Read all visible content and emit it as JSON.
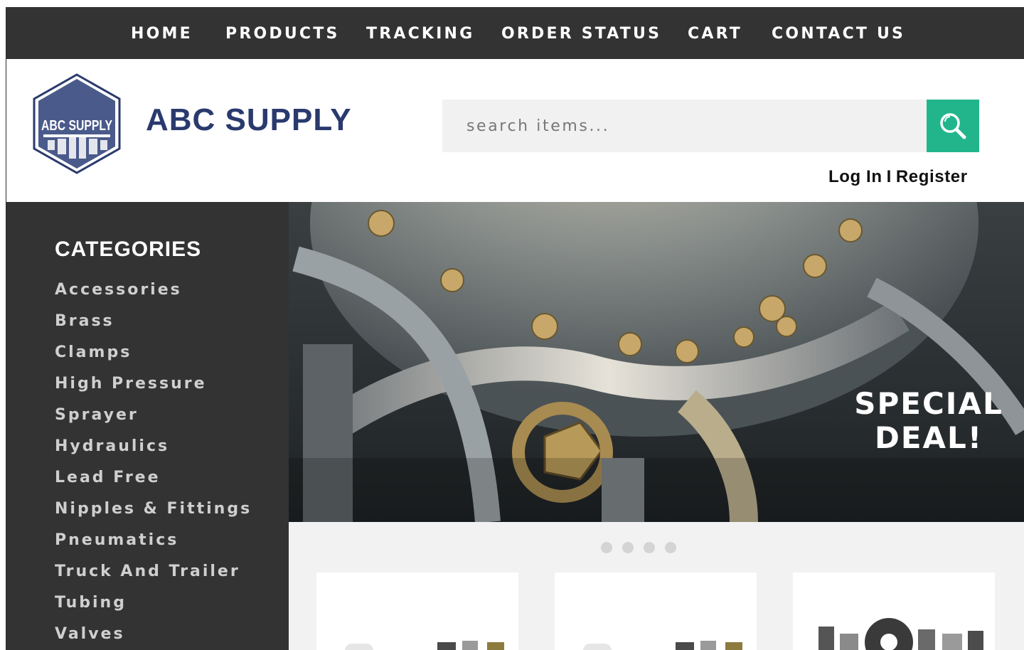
{
  "nav": {
    "items": [
      "HOME",
      "PRODUCTS",
      "TRACKING",
      "ORDER STATUS",
      "CART",
      "CONTACT US"
    ]
  },
  "header": {
    "logo_text": "ABC SUPPLY",
    "brand_name": "ABC SUPPLY",
    "search": {
      "placeholder": "search items...",
      "button_icon": "search-icon"
    },
    "auth": {
      "login": "Log In",
      "separator": "I",
      "register": "Register"
    }
  },
  "sidebar": {
    "title": "CATEGORIES",
    "items": [
      "Accessories",
      "Brass",
      "Clamps",
      "High Pressure",
      "Sprayer",
      "Hydraulics",
      "Lead Free",
      "Nipples & Fittings",
      "Pneumatics",
      "Truck And Trailer",
      "Tubing",
      "Valves"
    ]
  },
  "hero": {
    "headline_line1": "SPECIAL",
    "headline_line2": "DEAL!",
    "slide_count": 4
  },
  "colors": {
    "dark": "#333333",
    "brand_navy": "#2a3a6e",
    "accent_green": "#22b58c",
    "light_bg": "#f2f2f2"
  }
}
